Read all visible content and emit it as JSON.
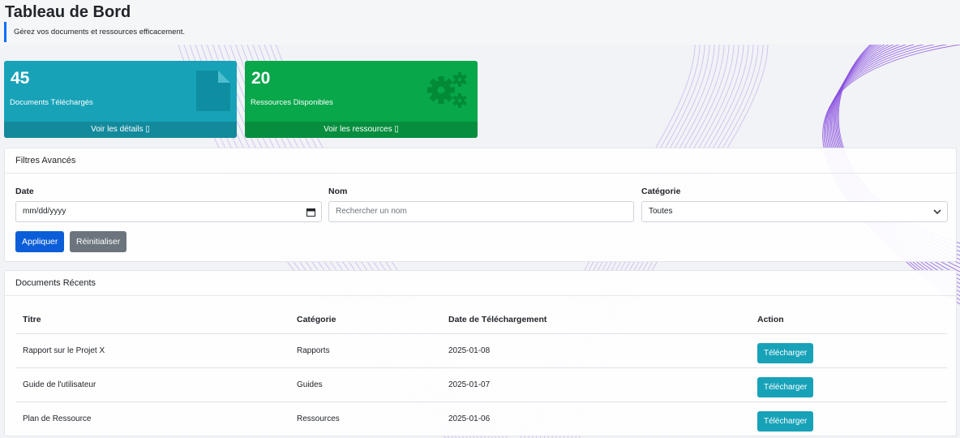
{
  "page": {
    "title": "Tableau de Bord",
    "subtitle": "Gérez vos documents et ressources efficacement."
  },
  "stats": [
    {
      "count": "45",
      "label": "Documents Téléchargés",
      "link": "Voir les détails ▯",
      "icon": "document-icon",
      "color": "#17a2b8"
    },
    {
      "count": "20",
      "label": "Ressources Disponibles",
      "link": "Voir les ressources ▯",
      "icon": "gears-icon",
      "color": "#07a74a"
    }
  ],
  "filters": {
    "heading": "Filtres Avancés",
    "date_label": "Date",
    "date_placeholder": "mm/dd/yyyy",
    "name_label": "Nom",
    "name_placeholder": "Rechercher un nom",
    "category_label": "Catégorie",
    "category_selected": "Toutes",
    "apply_label": "Appliquer",
    "reset_label": "Réinitialiser"
  },
  "recent": {
    "heading": "Documents Récents",
    "columns": [
      "Titre",
      "Catégorie",
      "Date de Téléchargement",
      "Action"
    ],
    "rows": [
      {
        "title": "Rapport sur le Projet X",
        "category": "Rapports",
        "date": "2025-01-08",
        "action": "Télécharger"
      },
      {
        "title": "Guide de l'utilisateur",
        "category": "Guides",
        "date": "2025-01-07",
        "action": "Télécharger"
      },
      {
        "title": "Plan de Ressource",
        "category": "Ressources",
        "date": "2025-01-06",
        "action": "Télécharger"
      }
    ]
  },
  "colors": {
    "primary": "#0b5ed7",
    "info": "#17a2b8",
    "success": "#07a74a",
    "secondary": "#6c757d",
    "wave": "#8a4fe0"
  }
}
